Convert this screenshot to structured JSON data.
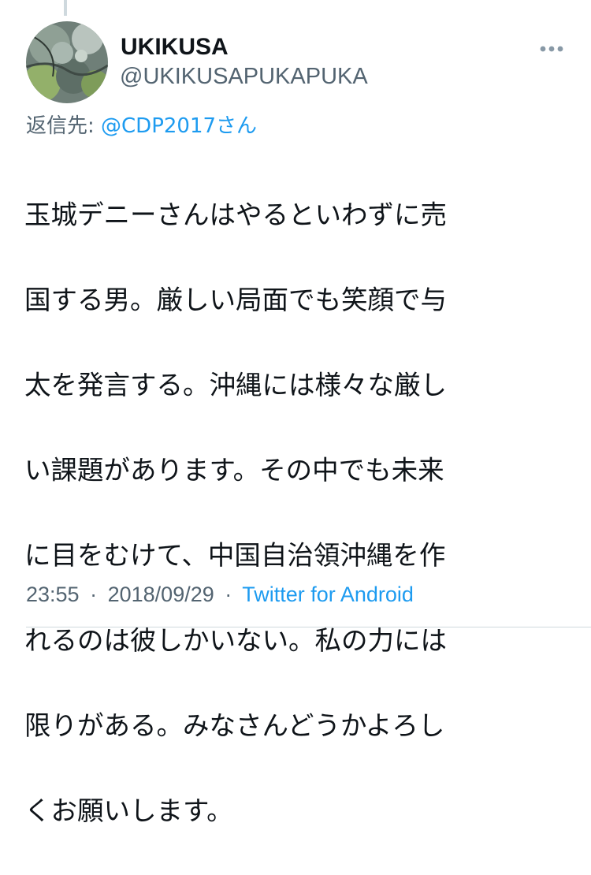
{
  "tweet": {
    "author": {
      "display_name": "UKIKUSA",
      "handle": "@UKIKUSAPUKAPUKA"
    },
    "reply": {
      "prefix": "返信先: ",
      "mention": "@CDP2017さん"
    },
    "text_lines": [
      "玉城デニーさんはやるといわずに売",
      "国する男。厳しい局面でも笑顔で与",
      "太を発言する。沖縄には様々な厳し",
      "い課題があります。その中でも未来",
      "に目をむけて、中国自治領沖縄を作",
      "れるのは彼しかいない。私の力には",
      "限りがある。みなさんどうかよろし",
      "くお願いします。"
    ],
    "time": "23:55",
    "separator": "·",
    "date": "2018/09/29",
    "source": "Twitter for Android"
  },
  "icons": {
    "more": "more-horizontal-icon",
    "avatar": "avatar-image"
  },
  "colors": {
    "text": "#0f1419",
    "secondary": "#536471",
    "link": "#1d9bf0"
  }
}
